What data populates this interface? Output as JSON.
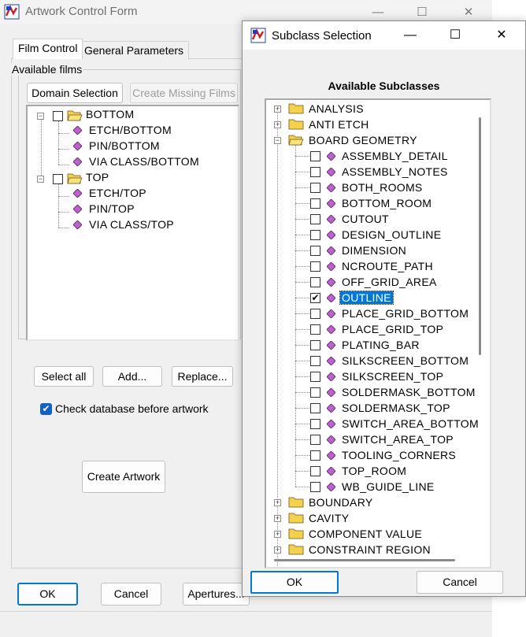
{
  "main_window": {
    "title": "Artwork Control Form",
    "tabs": [
      {
        "label": "Film Control"
      },
      {
        "label": "General Parameters"
      }
    ],
    "available_films_label": "Available films",
    "domain_selection_label": "Domain Selection",
    "create_missing_films_label": "Create Missing Films",
    "film_tree": [
      {
        "label": "BOTTOM",
        "children": [
          "ETCH/BOTTOM",
          "PIN/BOTTOM",
          "VIA CLASS/BOTTOM"
        ]
      },
      {
        "label": "TOP",
        "children": [
          "ETCH/TOP",
          "PIN/TOP",
          "VIA CLASS/TOP"
        ]
      }
    ],
    "select_all_label": "Select all",
    "add_label": "Add...",
    "replace_label": "Replace...",
    "check_db_label": "Check database before artwork",
    "check_db_checked": true,
    "create_artwork_label": "Create Artwork",
    "ok_label": "OK",
    "cancel_label": "Cancel",
    "apertures_label": "Apertures..."
  },
  "subclass_dialog": {
    "title": "Subclass Selection",
    "heading": "Available Subclasses",
    "collapsed_before": [
      "ANALYSIS",
      "ANTI ETCH"
    ],
    "expanded_class": "BOARD GEOMETRY",
    "subclasses": [
      {
        "label": "ASSEMBLY_DETAIL",
        "checked": false
      },
      {
        "label": "ASSEMBLY_NOTES",
        "checked": false
      },
      {
        "label": "BOTH_ROOMS",
        "checked": false
      },
      {
        "label": "BOTTOM_ROOM",
        "checked": false
      },
      {
        "label": "CUTOUT",
        "checked": false
      },
      {
        "label": "DESIGN_OUTLINE",
        "checked": false
      },
      {
        "label": "DIMENSION",
        "checked": false
      },
      {
        "label": "NCROUTE_PATH",
        "checked": false
      },
      {
        "label": "OFF_GRID_AREA",
        "checked": false
      },
      {
        "label": "OUTLINE",
        "checked": true,
        "selected": true
      },
      {
        "label": "PLACE_GRID_BOTTOM",
        "checked": false
      },
      {
        "label": "PLACE_GRID_TOP",
        "checked": false
      },
      {
        "label": "PLATING_BAR",
        "checked": false
      },
      {
        "label": "SILKSCREEN_BOTTOM",
        "checked": false
      },
      {
        "label": "SILKSCREEN_TOP",
        "checked": false
      },
      {
        "label": "SOLDERMASK_BOTTOM",
        "checked": false
      },
      {
        "label": "SOLDERMASK_TOP",
        "checked": false
      },
      {
        "label": "SWITCH_AREA_BOTTOM",
        "checked": false
      },
      {
        "label": "SWITCH_AREA_TOP",
        "checked": false
      },
      {
        "label": "TOOLING_CORNERS",
        "checked": false
      },
      {
        "label": "TOP_ROOM",
        "checked": false
      },
      {
        "label": "WB_GUIDE_LINE",
        "checked": false
      }
    ],
    "collapsed_after": [
      "BOUNDARY",
      "CAVITY",
      "COMPONENT VALUE",
      "CONSTRAINT REGION"
    ],
    "ok_label": "OK",
    "cancel_label": "Cancel"
  },
  "colors": {
    "gem": "#c060d0",
    "folder": "#f5d04a",
    "selection": "#0078d7",
    "accent": "#0078d4"
  },
  "icons": {
    "app": "app-logo-icon",
    "folder_open": "folder-open-icon",
    "folder_closed": "folder-closed-icon",
    "subclass": "diamond-gem-icon"
  }
}
